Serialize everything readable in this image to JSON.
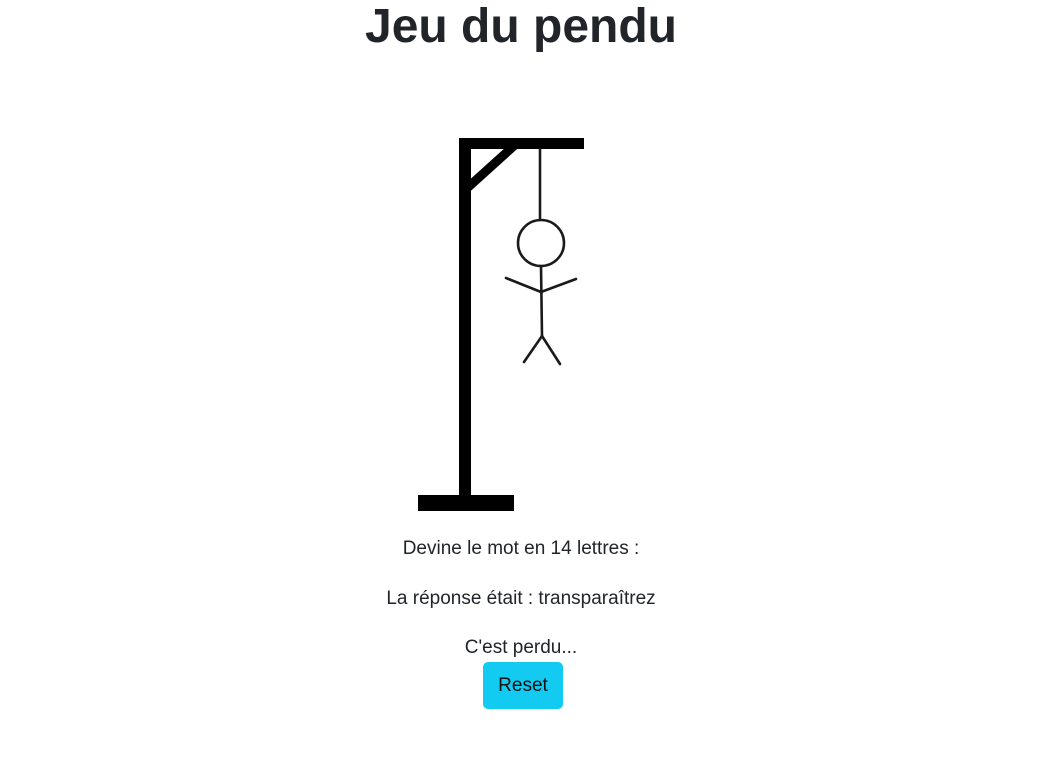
{
  "header": {
    "title": "Jeu du pendu"
  },
  "game": {
    "prompt": "Devine le mot en 14 lettres :",
    "answer_line": "La réponse était : transparaîtrez",
    "result": "C'est perdu..."
  },
  "actions": {
    "reset_label": "Reset"
  },
  "colors": {
    "button_bg": "#13caf0",
    "text": "#212529",
    "gallows": "#000000"
  },
  "drawing": {
    "icon": "hangman-figure",
    "stage": "complete"
  }
}
